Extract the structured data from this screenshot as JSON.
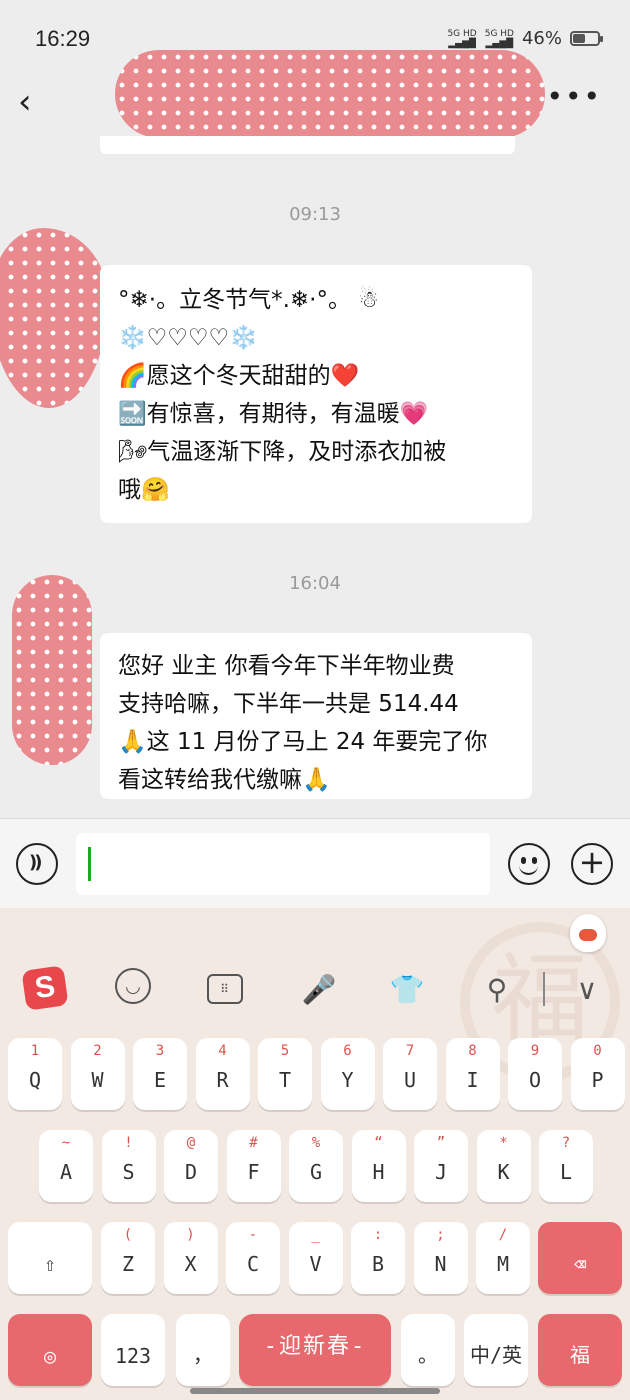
{
  "status_bar": {
    "time": "16:29",
    "signal_1": "5G HD",
    "signal_2": "5G HD",
    "battery": "46%"
  },
  "nav": {
    "back_icon": "chevron-left-icon",
    "more_icon": "ellipsis-icon",
    "more_label": "•••"
  },
  "messages": [
    {
      "timestamp": "09:13",
      "lines": [
        "°❄·。立冬节气*.❄·°。 ☃",
        "❄️♡♡♡♡❄️",
        "🌈愿这个冬天甜甜的❤️",
        "🔜有惊喜，有期待，有温暖💗",
        "🌬气温逐渐下降，及时添衣加被",
        "哦🤗"
      ]
    },
    {
      "timestamp": "16:04",
      "lines": [
        "您好 业主  你看今年下半年物业费",
        "支持哈嘛，下半年一共是 514.44",
        "🙏这 11 月份了马上 24 年要完了你",
        "看这转给我代缴嘛🙏"
      ]
    }
  ],
  "input_bar": {
    "voice_icon": "voice-icon",
    "text_value": "",
    "emoji_icon": "emoji-icon",
    "plus_icon": "plus-icon",
    "plus_label": "+"
  },
  "keyboard": {
    "toolbar": {
      "logo_label": "S",
      "emoji_label": "◡",
      "keyboard_label": "⠿",
      "mic_label": "🎤",
      "shirt_label": "👕",
      "search_label": "⚲",
      "collapse_label": "∨"
    },
    "row1": [
      {
        "key": "Q",
        "sub": "1"
      },
      {
        "key": "W",
        "sub": "2"
      },
      {
        "key": "E",
        "sub": "3"
      },
      {
        "key": "R",
        "sub": "4"
      },
      {
        "key": "T",
        "sub": "5"
      },
      {
        "key": "Y",
        "sub": "6"
      },
      {
        "key": "U",
        "sub": "7"
      },
      {
        "key": "I",
        "sub": "8"
      },
      {
        "key": "O",
        "sub": "9"
      },
      {
        "key": "P",
        "sub": "0"
      }
    ],
    "row2": [
      {
        "key": "A",
        "sub": "~"
      },
      {
        "key": "S",
        "sub": "!"
      },
      {
        "key": "D",
        "sub": "@"
      },
      {
        "key": "F",
        "sub": "#"
      },
      {
        "key": "G",
        "sub": "%"
      },
      {
        "key": "H",
        "sub": "“"
      },
      {
        "key": "J",
        "sub": "”"
      },
      {
        "key": "K",
        "sub": "*"
      },
      {
        "key": "L",
        "sub": "?"
      }
    ],
    "row3": [
      {
        "key": "Z",
        "sub": "("
      },
      {
        "key": "X",
        "sub": ")"
      },
      {
        "key": "C",
        "sub": "-"
      },
      {
        "key": "V",
        "sub": "_"
      },
      {
        "key": "B",
        "sub": ":"
      },
      {
        "key": "N",
        "sub": ";"
      },
      {
        "key": "M",
        "sub": "/"
      }
    ],
    "shift_label": "⇧",
    "backspace_label": "⌫",
    "symbol_label": "◎",
    "num_label": "123",
    "comma_label": "，",
    "space_label": "-迎新春-",
    "period_label": "。",
    "lang_label": "中/英",
    "fu_label": "福"
  }
}
